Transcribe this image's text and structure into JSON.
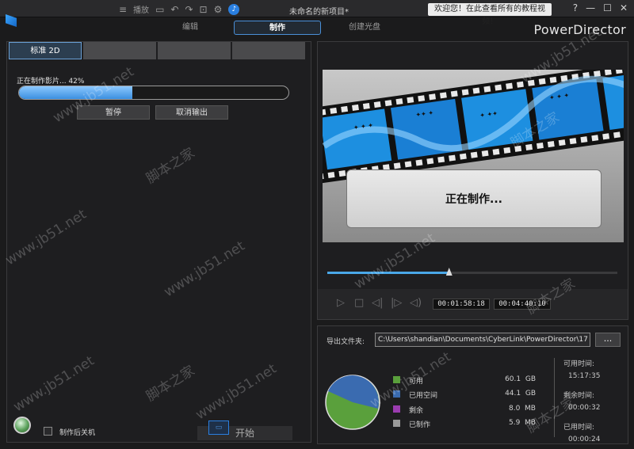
{
  "titlebar": {
    "menu_label": "播放",
    "project_title": "未命名的新项目*",
    "promo_text": "欢迎您！在此查看所有的教程视频！",
    "icons": [
      "menu-icon",
      "undo-icon",
      "redo-icon",
      "screen-icon",
      "gear-icon",
      "bell-icon"
    ],
    "window_controls": [
      "?",
      "—",
      "☐",
      "✕"
    ]
  },
  "mode_tabs": [
    {
      "label": "编辑",
      "active": false
    },
    {
      "label": "制作",
      "active": true
    },
    {
      "label": "创建光盘",
      "active": false
    }
  ],
  "brand": "PowerDirector",
  "sub_tabs": [
    {
      "label": "标准 2D",
      "active": true
    },
    {
      "label": "",
      "active": false
    },
    {
      "label": "",
      "active": false
    },
    {
      "label": "",
      "active": false
    }
  ],
  "progress": {
    "label": "正在制作影片... 42%",
    "percent": 42
  },
  "buttons": {
    "pause": "暂停",
    "cancel": "取消输出",
    "start": "开始"
  },
  "shutdown_checkbox": {
    "label": "制作后关机",
    "checked": false
  },
  "preview": {
    "status_text": "正在制作...",
    "seek_fraction": 0.42,
    "time_current": "00:01:58:18",
    "time_total": "00:04:40:10"
  },
  "export": {
    "label": "导出文件夹:",
    "path": "C:\\Users\\shandian\\Documents\\CyberLink\\PowerDirector\\17",
    "browse_label": "..."
  },
  "disk_usage": {
    "legend": [
      {
        "name": "可用",
        "value": "60.1",
        "unit": "GB",
        "color": "#5aa03c"
      },
      {
        "name": "已用空间",
        "value": "44.1",
        "unit": "GB",
        "color": "#3a6bb0"
      },
      {
        "name": "剩余",
        "value": "8.0",
        "unit": "MB",
        "color": "#9b3cb0"
      },
      {
        "name": "已制作",
        "value": "5.9",
        "unit": "MB",
        "color": "#9a9a9a"
      }
    ]
  },
  "time_info": {
    "available_label": "可用时间:",
    "available_value": "15:17:35",
    "remaining_label": "剩余时间:",
    "remaining_value": "00:00:32",
    "elapsed_label": "已用时间:",
    "elapsed_value": "00:00:24"
  },
  "watermarks": [
    "脚本之家",
    "www.jb51.net"
  ]
}
